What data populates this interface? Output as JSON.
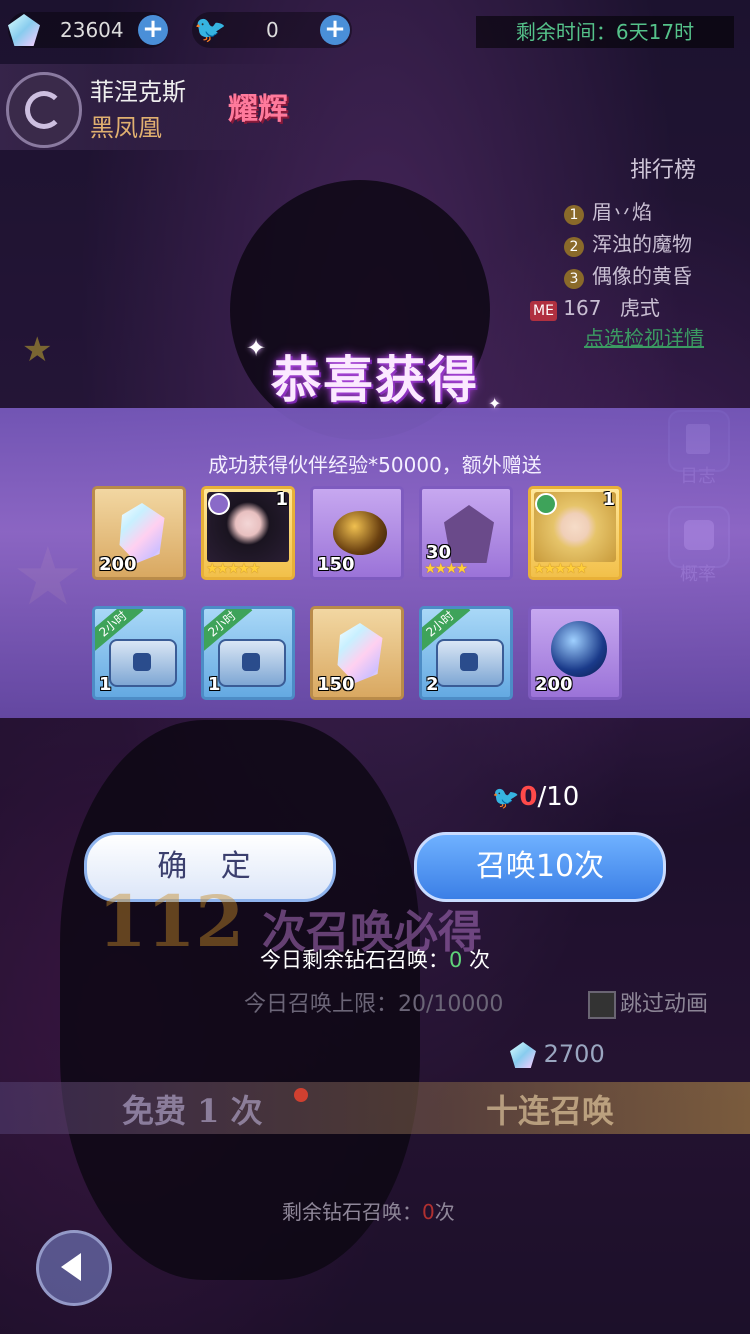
{
  "top": {
    "diamond_count": "23604",
    "bird_count": "0",
    "timer": "剩余时间：6天17时"
  },
  "banner": {
    "name": "菲涅克斯",
    "subname": "黑凤凰",
    "badge": "耀辉"
  },
  "ranking": {
    "title": "排行榜",
    "rows": [
      {
        "rank": "1",
        "name": "眉丷焰"
      },
      {
        "rank": "2",
        "name": "浑浊的魔物"
      },
      {
        "rank": "3",
        "name": "偶像的黄昏"
      }
    ],
    "me_label": "ME",
    "me_rank": "167",
    "me_name": "虎式",
    "detail_link": "点选检视详情"
  },
  "side": {
    "log_label": "日志",
    "prob_label": "概率"
  },
  "reward": {
    "title": "恭喜获得",
    "subtitle": "成功获得伙伴经验*50000，额外赠送",
    "items": [
      {
        "kind": "gem",
        "qty": "200"
      },
      {
        "kind": "char-dark",
        "count": "1",
        "stars": "★★★★★"
      },
      {
        "kind": "egg",
        "qty": "150"
      },
      {
        "kind": "shard",
        "qty": "30",
        "stars": "★★★★"
      },
      {
        "kind": "char-blonde",
        "count": "1",
        "stars": "★★★★★"
      },
      {
        "kind": "chest",
        "tag": "2小时",
        "qty": "1"
      },
      {
        "kind": "chest",
        "tag": "2小时",
        "qty": "1"
      },
      {
        "kind": "gem",
        "qty": "150"
      },
      {
        "kind": "chest-gold",
        "tag": "2小时",
        "qty": "2"
      },
      {
        "kind": "orb",
        "qty": "200"
      }
    ]
  },
  "summon": {
    "progress": "0",
    "progress_total": "/10",
    "confirm_label": "确 定",
    "summon_label": "召唤10次",
    "guarantee_num": "112",
    "guarantee_text": "次召唤必得",
    "today_prefix": "今日剩余钻石召唤：",
    "today_value": "0",
    "today_suffix": " 次",
    "limit_text": "今日召唤上限：",
    "limit_value": "20/10000",
    "skip_label": "跳过动画",
    "diamond_cost": "2700",
    "free_label": "免费 1 次",
    "ten_label": "十连召唤",
    "remain_prefix": "剩余钻石召唤：",
    "remain_value": "0",
    "remain_suffix": "次"
  },
  "colors": {
    "accent_green": "#55c28a",
    "accent_red": "#ff4a4a",
    "panel_purple": "#9b73d8",
    "button_blue": "#3b7fe6"
  }
}
